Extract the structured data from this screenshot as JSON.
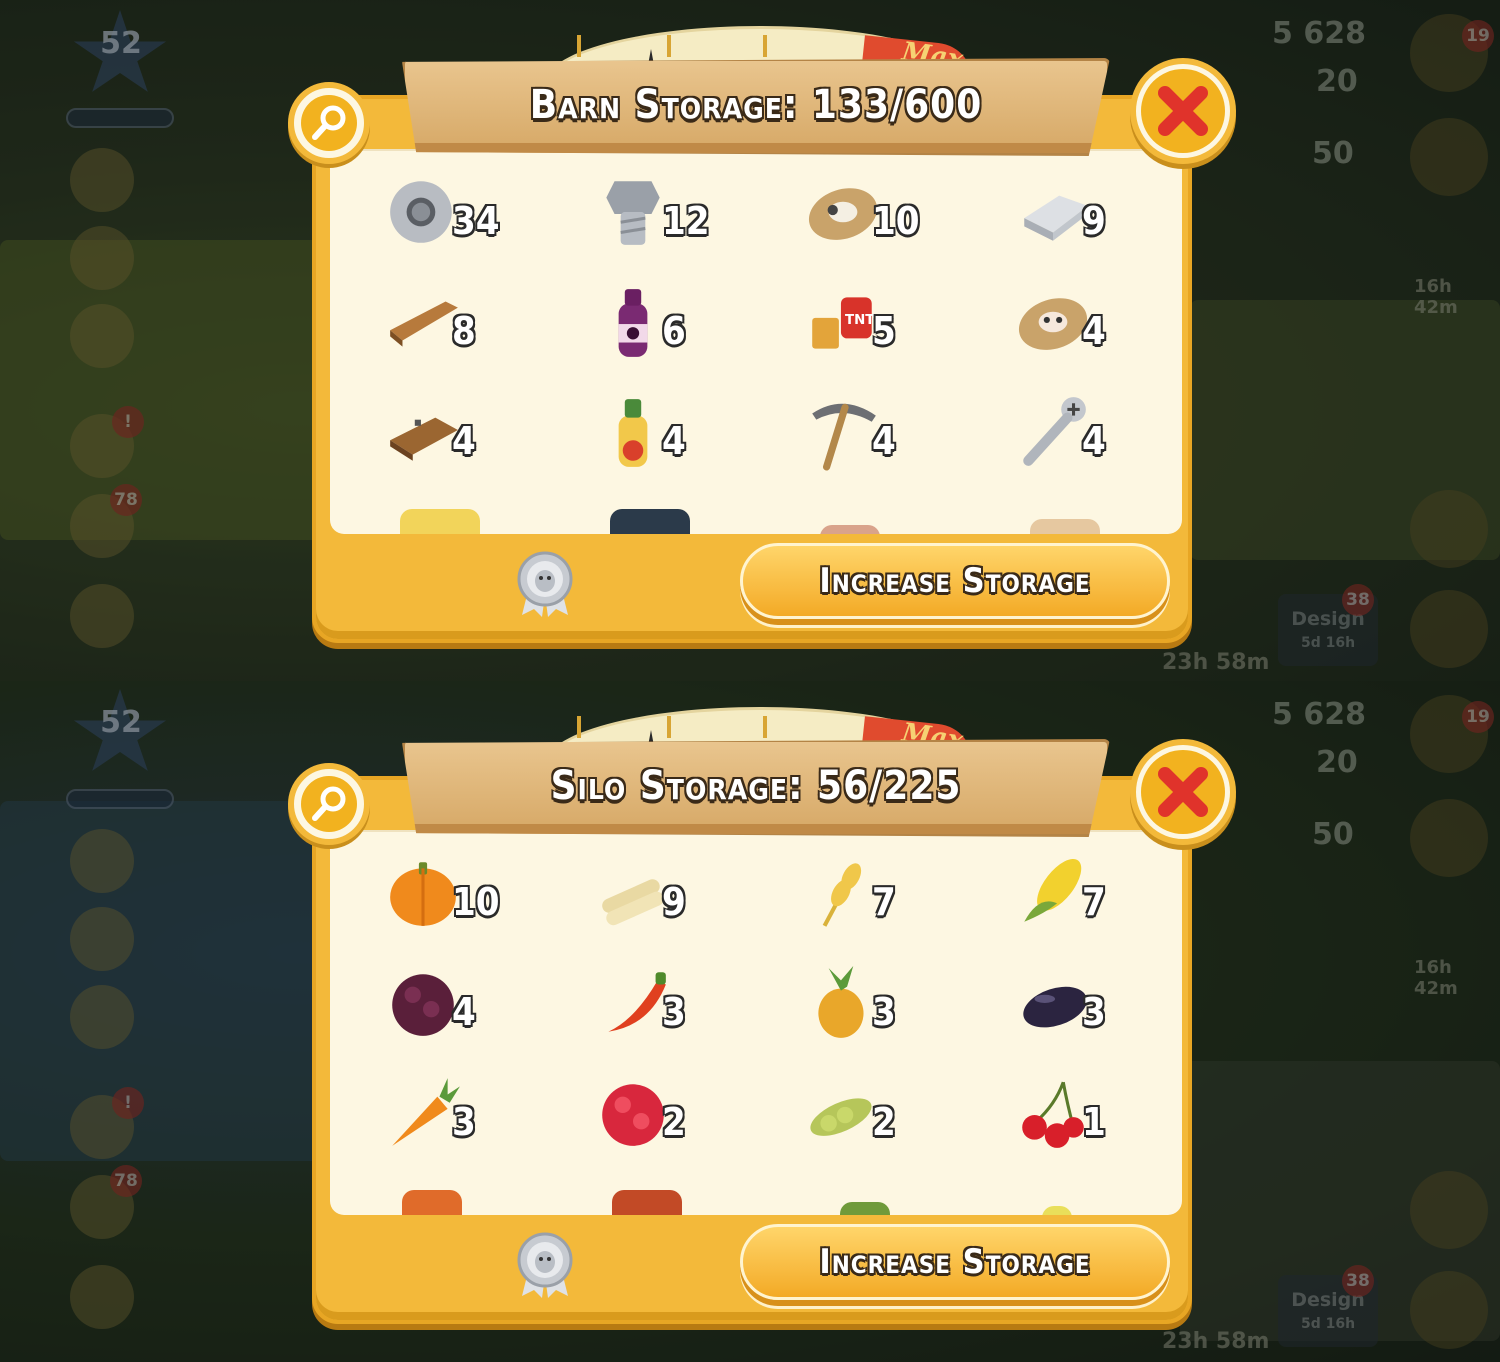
{
  "hud": {
    "level": "52",
    "coins": "5 628",
    "diamonds": "20",
    "vouchers": "50",
    "gift_badge": "19",
    "alert_badge": "!",
    "news_badge": "78",
    "design_badge": "38",
    "design_label": "Design",
    "design_timer": "5d 16h",
    "event_timer": "16h 42m",
    "market_timer": "23h 58m"
  },
  "barn": {
    "title": "Barn Storage: 133/600",
    "max_label": "Max",
    "button_label": "Increase Storage",
    "items": [
      {
        "icon": "duct-tape-icon",
        "count": "34"
      },
      {
        "icon": "bolt-icon",
        "count": "12"
      },
      {
        "icon": "sheep-feed-icon",
        "count": "10"
      },
      {
        "icon": "silver-bar-icon",
        "count": "9"
      },
      {
        "icon": "plank-icon",
        "count": "8"
      },
      {
        "icon": "blackberry-juice-icon",
        "count": "6"
      },
      {
        "icon": "tnt-icon",
        "count": "5"
      },
      {
        "icon": "cow-feed-icon",
        "count": "4"
      },
      {
        "icon": "land-deed-icon",
        "count": "4"
      },
      {
        "icon": "tomato-juice-icon",
        "count": "4"
      },
      {
        "icon": "pickaxe-icon",
        "count": "4"
      },
      {
        "icon": "screw-icon",
        "count": "4"
      }
    ]
  },
  "silo": {
    "title": "Silo Storage: 56/225",
    "max_label": "Max",
    "button_label": "Increase Storage",
    "items": [
      {
        "icon": "pumpkin-icon",
        "count": "10"
      },
      {
        "icon": "sugarcane-icon",
        "count": "9"
      },
      {
        "icon": "wheat-icon",
        "count": "7"
      },
      {
        "icon": "corn-icon",
        "count": "7"
      },
      {
        "icon": "blackberry-icon",
        "count": "4"
      },
      {
        "icon": "chili-pepper-icon",
        "count": "3"
      },
      {
        "icon": "pineapple-icon",
        "count": "3"
      },
      {
        "icon": "bean-icon",
        "count": "3"
      },
      {
        "icon": "carrot-icon",
        "count": "3"
      },
      {
        "icon": "raspberry-icon",
        "count": "2"
      },
      {
        "icon": "soybean-icon",
        "count": "2"
      },
      {
        "icon": "cherry-icon",
        "count": "1"
      }
    ]
  },
  "colors": {
    "frame": "#f3b93a",
    "panel": "#fdf7e2",
    "banner": "#d6a866",
    "close_x": "#e0332b"
  }
}
